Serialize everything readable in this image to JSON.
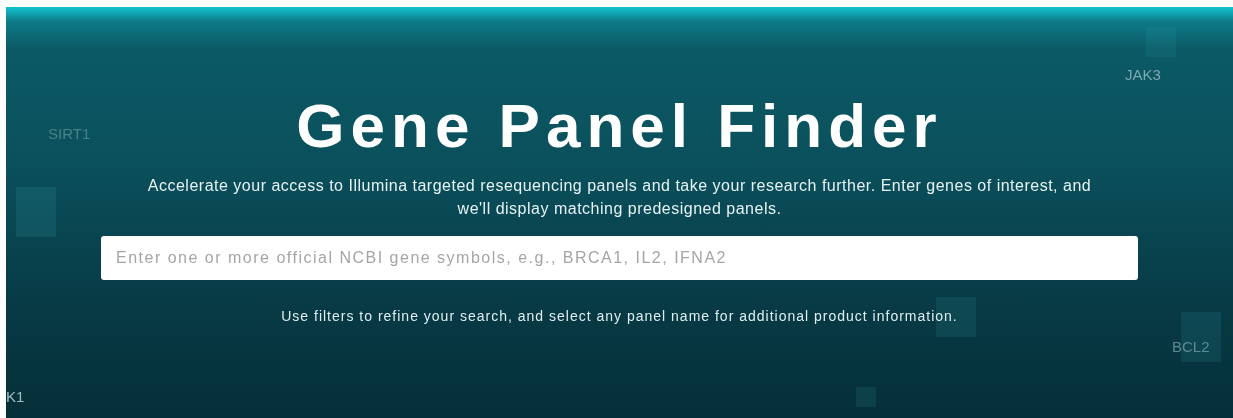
{
  "hero": {
    "title": "Gene Panel Finder",
    "description": "Accelerate your access to Illumina targeted resequencing panels and take your research further. Enter genes of interest, and we'll display matching predesigned panels.",
    "search": {
      "placeholder": "Enter one or more official NCBI gene symbols, e.g., BRCA1, IL2, IFNA2"
    },
    "hint": "Use filters to refine your search, and select any panel name for additional product information.",
    "gene_labels": [
      {
        "text": "JAK3"
      },
      {
        "text": "SIRT1"
      },
      {
        "text": "BCL2"
      },
      {
        "text": "K1"
      }
    ]
  }
}
